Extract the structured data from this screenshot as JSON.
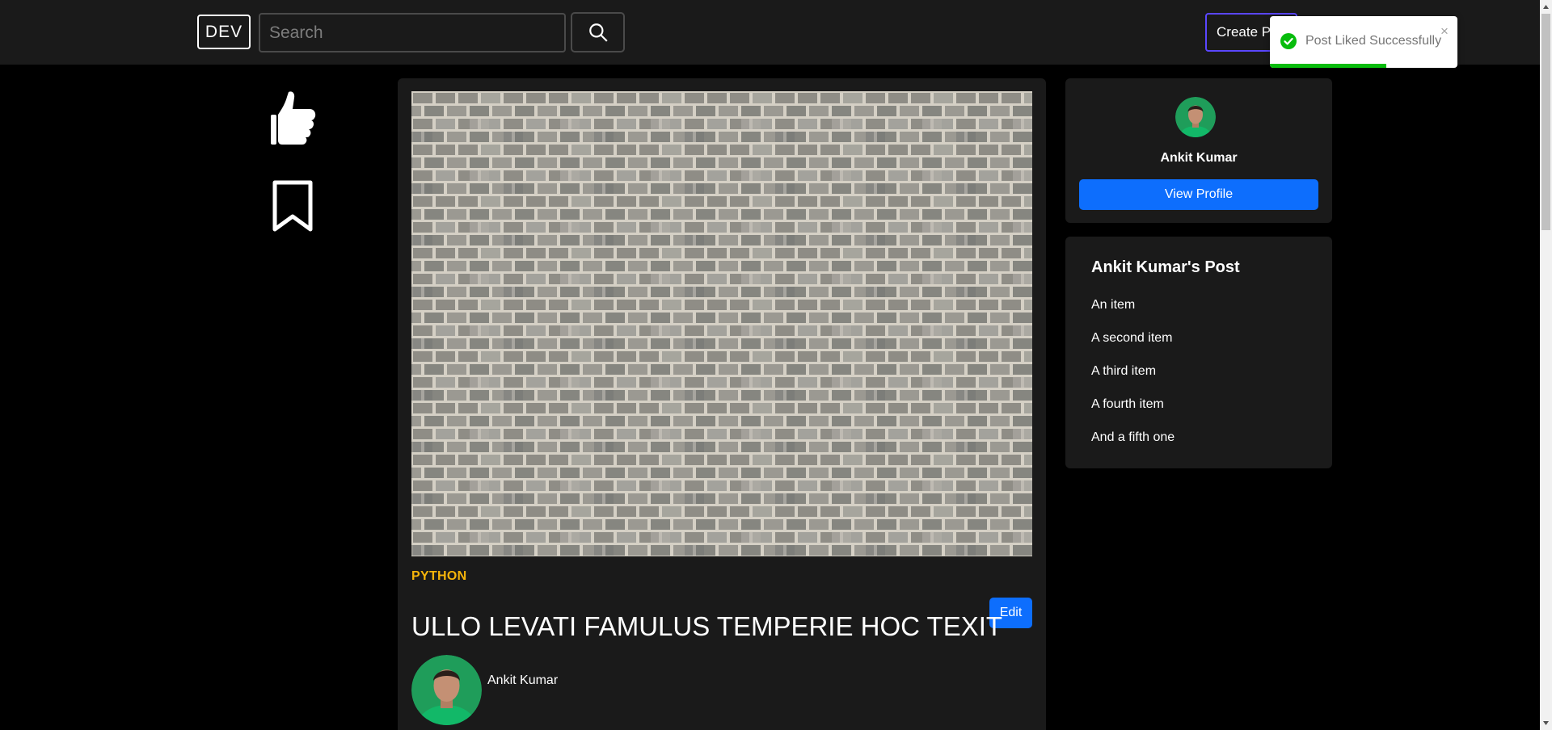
{
  "header": {
    "logo": "DEV",
    "search_placeholder": "Search",
    "search_value": "",
    "create_post_label": "Create Post"
  },
  "sidebar": {
    "like_icon": "thumbs-up-icon",
    "bookmark_icon": "bookmark-icon"
  },
  "post": {
    "tag": "PYTHON",
    "title": "ULLO LEVATI FAMULUS TEMPERIE HOC TEXIT",
    "edit_label": "Edit",
    "author": "Ankit Kumar"
  },
  "profile": {
    "name": "Ankit Kumar",
    "view_profile_label": "View Profile"
  },
  "author_posts": {
    "heading": "Ankit Kumar's Post",
    "items": [
      "An item",
      "A second item",
      "A third item",
      "A fourth item",
      "And a fifth one"
    ]
  },
  "toast": {
    "message": "Post Liked Successfully",
    "close_symbol": "×",
    "progress": 0.62,
    "color": "#07bc0c"
  },
  "colors": {
    "page_bg": "#000000",
    "card_bg": "#1a1a1a",
    "primary": "#0d6efd",
    "tag": "#f5b40a",
    "create_border": "#5a46ff"
  }
}
